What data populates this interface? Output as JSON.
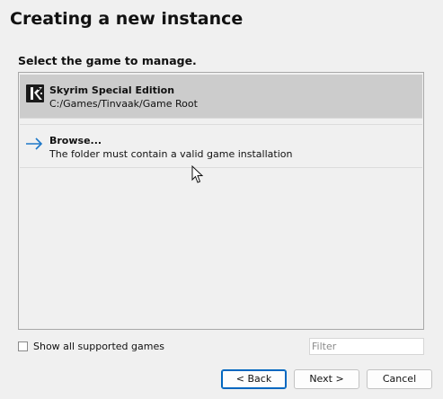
{
  "page": {
    "title": "Creating a new instance",
    "subtitle": "Select the game to manage."
  },
  "games": {
    "items": [
      {
        "name": "Skyrim Special Edition",
        "description": "C:/Games/Tinvaak/Game Root",
        "icon": "skyrim-icon",
        "selected": true
      },
      {
        "name": "Browse...",
        "description": "The folder must contain a valid game installation",
        "icon": "arrow-right-icon",
        "selected": false
      }
    ]
  },
  "options": {
    "show_all_label": "Show all supported games",
    "show_all_checked": false
  },
  "filter": {
    "placeholder": "Filter",
    "value": ""
  },
  "buttons": {
    "back": "< Back",
    "next": "Next >",
    "cancel": "Cancel"
  },
  "colors": {
    "background": "#f0f0f0",
    "selected_row": "#cccccc",
    "accent": "#0067c0",
    "browse_arrow": "#1e78c8"
  }
}
